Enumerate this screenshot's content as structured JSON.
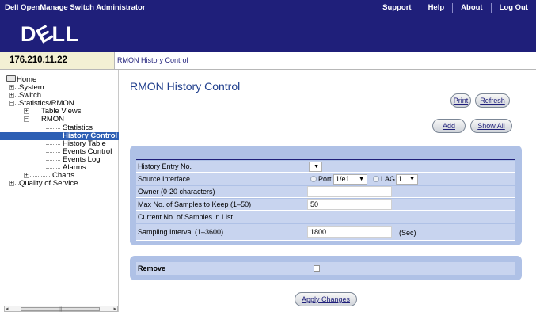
{
  "header": {
    "app_title": "Dell OpenManage Switch Administrator",
    "links": [
      "Support",
      "Help",
      "About",
      "Log Out"
    ],
    "logo_text": "DELL",
    "colors": {
      "header_bg": "#1f1f7a",
      "ip_bg": "#f3f0d4",
      "panel_bg": "#afc1e6",
      "selected_bg": "#2d5fb4"
    }
  },
  "ip_address": "176.210.11.22",
  "breadcrumb": "RMON History Control",
  "tree": {
    "home": "Home",
    "system": "System",
    "switch": "Switch",
    "statistics_rmon": "Statistics/RMON",
    "table_views": "Table Views",
    "rmon": "RMON",
    "statistics": "Statistics",
    "history_control": "History Control",
    "history_table": "History Table",
    "events_control": "Events Control",
    "events_log": "Events Log",
    "alarms": "Alarms",
    "charts": "Charts",
    "quality_of_service": "Quality of Service"
  },
  "page": {
    "title": "RMON History Control",
    "buttons": {
      "print": "Print",
      "refresh": "Refresh",
      "add": "Add",
      "show_all": "Show All",
      "apply_changes": "Apply Changes"
    }
  },
  "form": {
    "history_entry_label": "History Entry No.",
    "history_entry_value": "",
    "source_interface_label": "Source Interface",
    "port_label": "Port",
    "port_value": "1/e1",
    "lag_label": "LAG",
    "lag_value": "1",
    "owner_label": "Owner (0-20 characters)",
    "owner_value": "",
    "max_samples_label": "Max No. of Samples to Keep (1–50)",
    "max_samples_value": "50",
    "current_samples_label": "Current No. of Samples in List",
    "current_samples_value": "",
    "sampling_interval_label": "Sampling Interval (1–3600)",
    "sampling_interval_value": "1800",
    "sampling_interval_unit": "(Sec)",
    "remove_label": "Remove",
    "remove_checked": false
  }
}
